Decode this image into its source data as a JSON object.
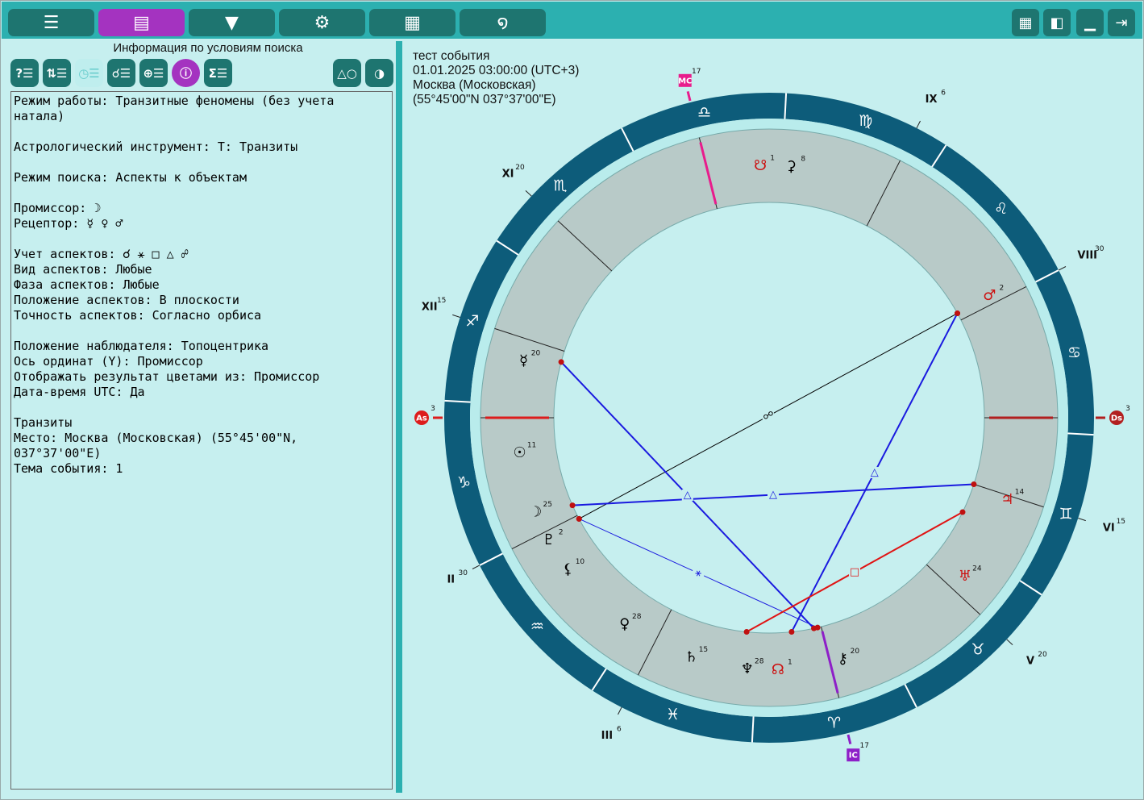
{
  "toolbar": {
    "tabs": [
      {
        "icon": "list-icon",
        "glyph": "☰",
        "active": false
      },
      {
        "icon": "layout-icon",
        "glyph": "▤",
        "active": true
      },
      {
        "icon": "dropdown-icon",
        "glyph": "▼",
        "active": false
      },
      {
        "icon": "gear-icon",
        "glyph": "⚙",
        "active": false
      },
      {
        "icon": "calculator-icon",
        "glyph": "▦",
        "active": false
      },
      {
        "icon": "galaxy-icon",
        "glyph": "໑",
        "active": false
      }
    ],
    "right": [
      {
        "icon": "grid-icon",
        "glyph": "▦"
      },
      {
        "icon": "panel-icon",
        "glyph": "◧"
      },
      {
        "icon": "minimize-icon",
        "glyph": "▁"
      },
      {
        "icon": "exit-icon",
        "glyph": "⇥"
      }
    ]
  },
  "left_panel": {
    "title": "Информация по условиям поиска",
    "tool_buttons": [
      {
        "icon": "help-list-icon",
        "glyph": "?☰",
        "style": "normal"
      },
      {
        "icon": "filter-list-icon",
        "glyph": "⇅☰",
        "style": "normal"
      },
      {
        "icon": "clock-list-icon",
        "glyph": "◷☰",
        "style": "light"
      },
      {
        "icon": "aspects-list-icon",
        "glyph": "☌☰",
        "style": "normal"
      },
      {
        "icon": "globe-list-icon",
        "glyph": "⊕☰",
        "style": "normal"
      },
      {
        "icon": "info-icon",
        "glyph": "ⓘ",
        "style": "violet"
      },
      {
        "icon": "sigma-list-icon",
        "glyph": "Σ☰",
        "style": "normal"
      }
    ],
    "right_buttons": [
      {
        "icon": "shapes-icon",
        "glyph": "△○"
      },
      {
        "icon": "yin-yang-icon",
        "glyph": "◑"
      }
    ],
    "lines": [
      "Режим работы: Транзитные феномены (без учета натала)",
      "",
      "Астрологический инструмент: Т: Транзиты",
      "",
      "Режим поиска: Аспекты к объектам",
      "",
      "Промиссор: ☽",
      "Рецептор: ☿ ♀ ♂",
      "",
      "Учет аспектов: ☌ ⚹ □ △ ☍",
      "Вид аспектов: Любые",
      "Фаза аспектов: Любые",
      "Положение аспектов: В плоскости",
      "Точность аспектов: Согласно орбиса",
      "",
      "Положение наблюдателя: Топоцентрика",
      "Ось ординат (Y): Промиссор",
      "Отображать результат цветами из: Промиссор",
      "Дата-время UTC: Да",
      "",
      "Транзиты",
      "Место: Москва (Московская) (55°45'00\"N, 037°37'00\"E)",
      "Тема события: 1"
    ]
  },
  "event": {
    "name": "тест события",
    "datetime": "01.01.2025 03:00:00 (UTC+3)",
    "place": "Москва (Московская)",
    "coords": "(55°45'00\"N 037°37'00\"E)"
  },
  "chart": {
    "asc_lon": 273,
    "signs": [
      "♈",
      "♉",
      "♊",
      "♋",
      "♌",
      "♍",
      "♎",
      "♏",
      "♐",
      "♑",
      "♒",
      "♓"
    ],
    "houses": [
      {
        "label": "I",
        "lon": 273,
        "deg": "3"
      },
      {
        "label": "II",
        "lon": 300,
        "deg": "30"
      },
      {
        "label": "III",
        "lon": 336,
        "deg": "6"
      },
      {
        "label": "IV",
        "lon": 17,
        "deg": "17"
      },
      {
        "label": "V",
        "lon": 50,
        "deg": "20"
      },
      {
        "label": "VI",
        "lon": 75,
        "deg": "15"
      },
      {
        "label": "VII",
        "lon": 93,
        "deg": "3"
      },
      {
        "label": "VIII",
        "lon": 120,
        "deg": "30"
      },
      {
        "label": "IX",
        "lon": 156,
        "deg": "6"
      },
      {
        "label": "X",
        "lon": 197,
        "deg": "17"
      },
      {
        "label": "XI",
        "lon": 230,
        "deg": "20"
      },
      {
        "label": "XII",
        "lon": 255,
        "deg": "15"
      }
    ],
    "house_number_labels": [
      {
        "label": "III",
        "deg": "6",
        "lon": 336
      },
      {
        "label": "II",
        "deg": "30",
        "lon": 300
      },
      {
        "label": "XII",
        "deg": "15",
        "lon": 255
      },
      {
        "label": "XI",
        "deg": "20",
        "lon": 230
      },
      {
        "label": "IX",
        "deg": "6",
        "lon": 156
      },
      {
        "label": "VIII",
        "deg": "30",
        "lon": 120
      },
      {
        "label": "VI",
        "deg": "15",
        "lon": 75
      },
      {
        "label": "V",
        "deg": "20",
        "lon": 50
      }
    ],
    "angles": [
      {
        "label": "As",
        "deg": "3",
        "lon": 273,
        "color": "#dd1c1c",
        "shape": "circle"
      },
      {
        "label": "Ds",
        "deg": "3",
        "lon": 93,
        "color": "#b21f1f",
        "shape": "circle"
      },
      {
        "label": "MC",
        "deg": "17",
        "lon": 197,
        "color": "#e81c8c",
        "shape": "square"
      },
      {
        "label": "IC",
        "deg": "17",
        "lon": 17,
        "color": "#8e1fc8",
        "shape": "square"
      }
    ],
    "planets": [
      {
        "name": "sun",
        "glyph": "☉",
        "deg": "11",
        "lon": 281,
        "color": "#000"
      },
      {
        "name": "mercury",
        "glyph": "☿",
        "deg": "20",
        "lon": 260,
        "color": "#000"
      },
      {
        "name": "pluto",
        "glyph": "♇",
        "deg": "2",
        "lon": 302,
        "color": "#000"
      },
      {
        "name": "lilith",
        "glyph": "⚸",
        "deg": "10",
        "lon": 310,
        "color": "#000"
      },
      {
        "name": "moon",
        "glyph": "☽",
        "deg": "25",
        "lon": 295,
        "color": "#000"
      },
      {
        "name": "venus",
        "glyph": "♀",
        "deg": "28",
        "lon": 328,
        "color": "#000"
      },
      {
        "name": "saturn",
        "glyph": "♄",
        "deg": "15",
        "lon": 345,
        "color": "#000"
      },
      {
        "name": "neptune",
        "glyph": "♆",
        "deg": "28",
        "lon": 358,
        "color": "#000"
      },
      {
        "name": "north-node",
        "glyph": "☊",
        "deg": "1",
        "lon": 5,
        "color": "#cc1010"
      },
      {
        "name": "chiron",
        "glyph": "⚷",
        "deg": "20",
        "lon": 20,
        "color": "#000"
      },
      {
        "name": "uranus",
        "glyph": "♅",
        "deg": "24",
        "lon": 54,
        "color": "#cc1010"
      },
      {
        "name": "jupiter",
        "glyph": "♃",
        "deg": "14",
        "lon": 74,
        "color": "#cc1010"
      },
      {
        "name": "mars",
        "glyph": "♂",
        "deg": "2",
        "lon": 122,
        "color": "#cc1010"
      },
      {
        "name": "south-node",
        "glyph": "☋",
        "deg": "1",
        "lon": 185,
        "color": "#cc1010"
      },
      {
        "name": "ceres",
        "glyph": "⚳",
        "deg": "8",
        "lon": 178,
        "color": "#000"
      }
    ],
    "aspects": [
      {
        "from": 301,
        "to": 16,
        "color": "#1a1adf",
        "width": 1,
        "glyph": "⚹"
      },
      {
        "from": 301,
        "to": 122,
        "color": "#000000",
        "width": 1,
        "glyph": "☍"
      },
      {
        "from": 297,
        "to": 75,
        "color": "#1a1adf",
        "width": 2,
        "glyph": "△"
      },
      {
        "from": 258,
        "to": 15,
        "color": "#1a1adf",
        "width": 2,
        "glyph": "△"
      },
      {
        "from": 9,
        "to": 122,
        "color": "#1a1adf",
        "width": 2,
        "glyph": "△"
      },
      {
        "from": 357,
        "to": 67,
        "color": "#e01414",
        "width": 2,
        "glyph": "□"
      }
    ]
  }
}
